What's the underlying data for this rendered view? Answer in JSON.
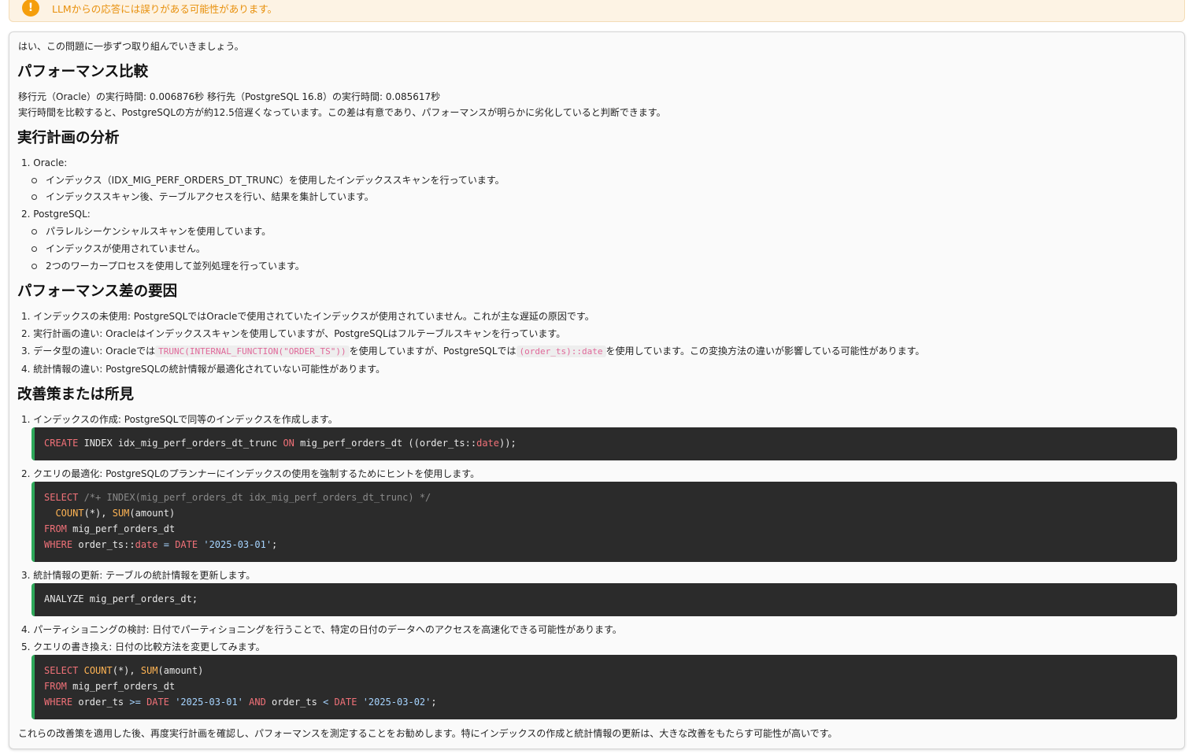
{
  "banner": {
    "icon": "warning-icon",
    "text": "LLMからの応答には誤りがある可能性があります。"
  },
  "intro": "はい、この問題に一歩ずつ取り組んでいきましょう。",
  "perf": {
    "heading": "パフォーマンス比較",
    "line1": "移行元（Oracle）の実行時間: 0.006876秒 移行先（PostgreSQL 16.8）の実行時間: 0.085617秒",
    "line2": "実行時間を比較すると、PostgreSQLの方が約12.5倍遅くなっています。この差は有意であり、パフォーマンスが明らかに劣化していると判断できます。"
  },
  "plan": {
    "heading": "実行計画の分析",
    "oracle": "1. Oracle:",
    "oracle_items": [
      "インデックス（IDX_MIG_PERF_ORDERS_DT_TRUNC）を使用したインデックススキャンを行っています。",
      "インデックススキャン後、テーブルアクセスを行い、結果を集計しています。"
    ],
    "pg": "2. PostgreSQL:",
    "pg_items": [
      "パラレルシーケンシャルスキャンを使用しています。",
      "インデックスが使用されていません。",
      "2つのワーカープロセスを使用して並列処理を行っています。"
    ]
  },
  "causes": {
    "heading": "パフォーマンス差の要因",
    "item1": "1. インデックスの未使用: PostgreSQLではOracleで使用されていたインデックスが使用されていません。これが主な遅延の原因です。",
    "item2": "2. 実行計画の違い: Oracleはインデックススキャンを使用していますが、PostgreSQLはフルテーブルスキャンを行っています。",
    "item3_a": "3. データ型の違い: Oracleでは",
    "item3_code1": "TRUNC(INTERNAL_FUNCTION(\"ORDER_TS\"))",
    "item3_b": "を使用していますが、PostgreSQLでは",
    "item3_code2": "(order_ts)::date",
    "item3_c": "を使用しています。この変換方法の違いが影響している可能性があります。",
    "item4": "4. 統計情報の違い: PostgreSQLの統計情報が最適化されていない可能性があります。"
  },
  "fixes": {
    "heading": "改善策または所見",
    "item1": "1. インデックスの作成: PostgreSQLで同等のインデックスを作成します。",
    "item2": "2. クエリの最適化: PostgreSQLのプランナーにインデックスの使用を強制するためにヒントを使用します。",
    "item3": "3. 統計情報の更新: テーブルの統計情報を更新します。",
    "item4": "4. パーティショニングの検討: 日付でパーティショニングを行うことで、特定の日付のデータへのアクセスを高速化できる可能性があります。",
    "item5": "5. クエリの書き換え: 日付の比較方法を変更してみます。",
    "code1": {
      "kw1": "CREATE",
      "p1": " INDEX idx_mig_perf_orders_dt_trunc ",
      "kw2": "ON",
      "p2": " mig_perf_orders_dt ((order_ts::",
      "ty": "date",
      "p3": "));"
    },
    "code2": {
      "l1_kw": "SELECT",
      "l1_cm": " /*+ INDEX(mig_perf_orders_dt idx_mig_perf_orders_dt_trunc) */",
      "l2_pad": "  ",
      "l2_f1": "COUNT",
      "l2_star": "(*)",
      "l2_sep": ", ",
      "l2_f2": "SUM",
      "l2_arg": "(amount)",
      "l3_kw": "FROM",
      "l3_p": " mig_perf_orders_dt",
      "l4_kw": "WHERE",
      "l4_p": " order_ts::",
      "l4_ty": "date",
      "l4_eq": " = ",
      "l4_kw2": "DATE",
      "l4_sp": " ",
      "l4_str": "'2025-03-01'",
      "l4_end": ";"
    },
    "code3": "ANALYZE mig_perf_orders_dt;",
    "code4": {
      "l1_kw": "SELECT",
      "l1_sp": " ",
      "l1_f1": "COUNT",
      "l1_star": "(*)",
      "l1_sep": ", ",
      "l1_f2": "SUM",
      "l1_arg": "(amount)",
      "l2_kw": "FROM",
      "l2_p": " mig_perf_orders_dt",
      "l3_kw": "WHERE",
      "l3_p1": " order_ts ",
      "l3_op1": ">=",
      "l3_sp1": " ",
      "l3_kw2": "DATE",
      "l3_sp2": " ",
      "l3_s1": "'2025-03-01'",
      "l3_sp3": " ",
      "l3_and": "AND",
      "l3_p2": " order_ts ",
      "l3_op2": "<",
      "l3_sp4": " ",
      "l3_kw3": "DATE",
      "l3_sp5": " ",
      "l3_s2": "'2025-03-02'",
      "l3_end": ";"
    }
  },
  "closing": "これらの改善策を適用した後、再度実行計画を確認し、パフォーマンスを測定することをお勧めします。特にインデックスの作成と統計情報の更新は、大きな改善をもたらす可能性が高いです。"
}
